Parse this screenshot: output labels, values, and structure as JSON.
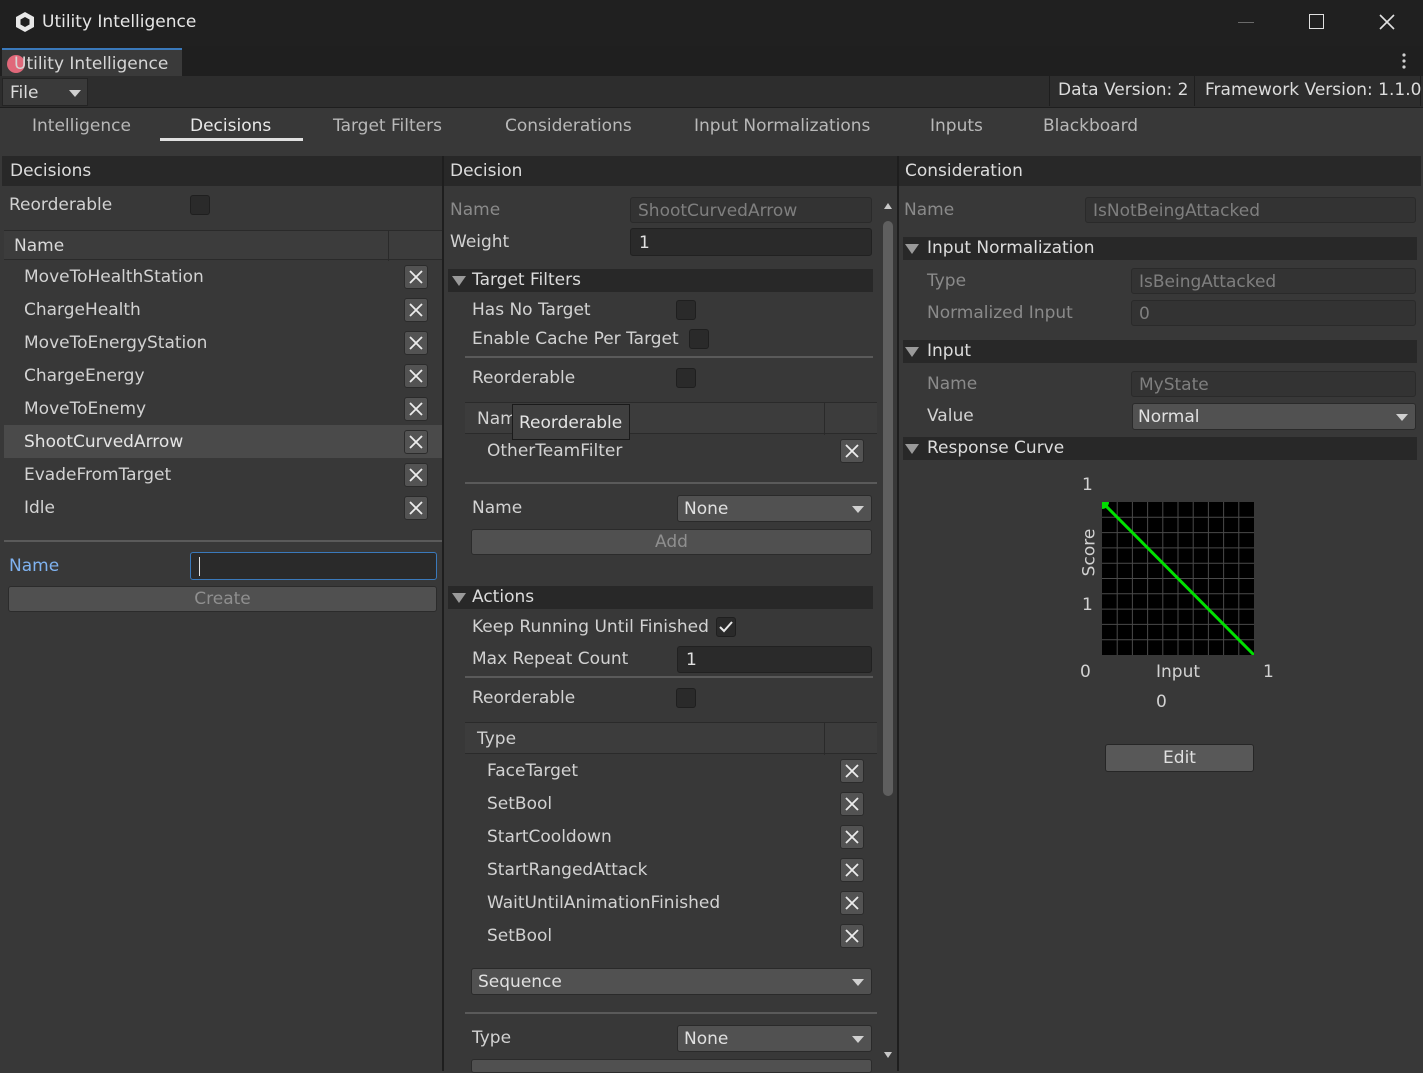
{
  "window": {
    "title": "Utility Intelligence",
    "tab_label": "Utility Intelligence"
  },
  "menu": {
    "file": "File",
    "data_version": "Data Version: 2",
    "framework_version": "Framework Version: 1.1.0"
  },
  "tabs": [
    "Intelligence",
    "Decisions",
    "Target Filters",
    "Considerations",
    "Input Normalizations",
    "Inputs",
    "Blackboard"
  ],
  "active_tab": "Decisions",
  "decisions_panel": {
    "header": "Decisions",
    "reorderable_label": "Reorderable",
    "column_name": "Name",
    "items": [
      "MoveToHealthStation",
      "ChargeHealth",
      "MoveToEnergyStation",
      "ChargeEnergy",
      "MoveToEnemy",
      "ShootCurvedArrow",
      "EvadeFromTarget",
      "Idle"
    ],
    "selected": "ShootCurvedArrow",
    "name_label": "Name",
    "name_value": "",
    "create_label": "Create"
  },
  "decision_panel": {
    "header": "Decision",
    "name_label": "Name",
    "name_value": "ShootCurvedArrow",
    "weight_label": "Weight",
    "weight_value": "1",
    "target_filters": {
      "header": "Target Filters",
      "has_no_target_label": "Has No Target",
      "enable_cache_label": "Enable Cache Per Target",
      "reorderable_label": "Reorderable",
      "column_name": "Nam",
      "tooltip": "Reorderable",
      "items": [
        "OtherTeamFilter"
      ],
      "name_label": "Name",
      "name_select": "None",
      "add_label": "Add"
    },
    "actions": {
      "header": "Actions",
      "keep_running_label": "Keep Running Until Finished",
      "keep_running_checked": true,
      "max_repeat_label": "Max Repeat Count",
      "max_repeat_value": "1",
      "reorderable_label": "Reorderable",
      "column_type": "Type",
      "items": [
        "FaceTarget",
        "SetBool",
        "StartCooldown",
        "StartRangedAttack",
        "WaitUntilAnimationFinished",
        "SetBool"
      ],
      "sequence_select": "Sequence",
      "type_label": "Type",
      "type_select": "None"
    }
  },
  "consideration_panel": {
    "header": "Consideration",
    "name_label": "Name",
    "name_value": "IsNotBeingAttacked",
    "input_normalization": {
      "header": "Input Normalization",
      "type_label": "Type",
      "type_value": "IsBeingAttacked",
      "normalized_label": "Normalized Input",
      "normalized_value": "0"
    },
    "input": {
      "header": "Input",
      "name_label": "Name",
      "name_value": "MyState",
      "value_label": "Value",
      "value_select": "Normal"
    },
    "response_curve": {
      "header": "Response Curve",
      "y_top": "1",
      "y_mid": "1",
      "y_label": "Score",
      "x_left": "0",
      "x_right": "1",
      "x_label": "Input",
      "input_value": "0",
      "edit_label": "Edit",
      "curve_color": "#00e000",
      "start_point": {
        "input": 0,
        "score": 1
      },
      "end_point": {
        "input": 1,
        "score": 0
      }
    }
  }
}
